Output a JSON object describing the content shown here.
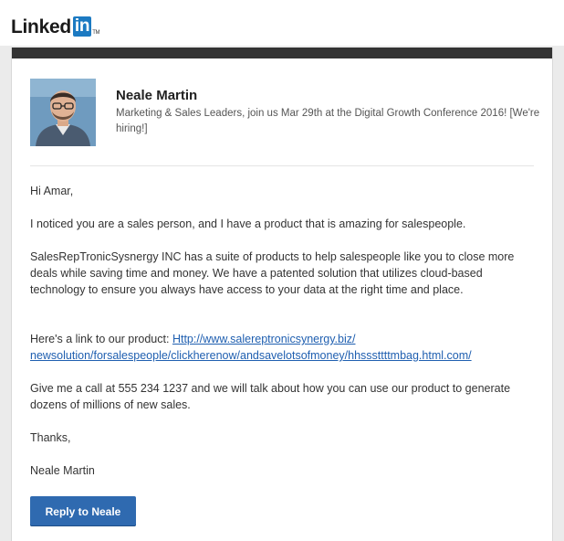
{
  "brand": {
    "logo_text": "Linked",
    "logo_in": "in",
    "logo_tm": "TM",
    "accent": "#1c7ac2"
  },
  "sender": {
    "name": "Neale Martin",
    "headline": "Marketing & Sales Leaders, join us Mar 29th at the Digital Growth Conference 2016! [We're hiring!]"
  },
  "message": {
    "greeting": "Hi Amar,",
    "para1": "I noticed you are a sales person, and I have a product that is amazing for salespeople.",
    "para2": "SalesRepTronicSysnergy INC has a suite of products to help salespeople like you to close more deals while saving time and money. We have a patented solution that utilizes cloud-based technology to ensure you always have access to your data at the right time and place.",
    "link_intro": "Here's a link to our product: ",
    "link_line1": "Http://www.salereptronicsynergy.biz/",
    "link_line2": "newsolution/forsalespeople/clickherenow/andsavelotsofmoney/hhsssttttmbag.html.com/",
    "para4": "Give me a call at 555 234 1237 and we will talk about how you can use our product to generate dozens of millions of new sales.",
    "closing": "Thanks,",
    "signature": "Neale Martin"
  },
  "actions": {
    "reply_label": "Reply to Neale",
    "reply_color": "#2f6ab0"
  }
}
